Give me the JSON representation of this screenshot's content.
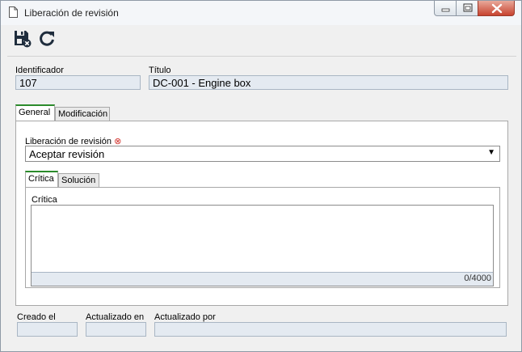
{
  "window": {
    "title": "Liberación de revisión",
    "icons": {
      "document": "document-icon",
      "minimize": "minimize-icon",
      "maximize": "maximize-icon",
      "close": "close-icon"
    }
  },
  "toolbar": {
    "save_close_icon": "save-close-icon",
    "refresh_icon": "refresh-icon"
  },
  "header": {
    "id_label": "Identificador",
    "id_value": "107",
    "title_label": "Título",
    "title_value": "DC-001 - Engine box"
  },
  "tabs": [
    {
      "label": "General",
      "active": true
    },
    {
      "label": "Modificación",
      "active": false
    }
  ],
  "general": {
    "release_label": "Liberación de revisión",
    "required_mark": "⊗",
    "release_value": "Aceptar revisión",
    "subtabs": [
      {
        "label": "Crítica",
        "active": true
      },
      {
        "label": "Solución",
        "active": false
      }
    ],
    "critique_label": "Crítica",
    "critique_value": "",
    "counter": "0/4000"
  },
  "footer": {
    "created_label": "Creado el",
    "created_value": "",
    "updated_label": "Actualizado en",
    "updated_value": "",
    "updated_by_label": "Actualizado por",
    "updated_by_value": ""
  },
  "colors": {
    "accent_tab": "#2b8b2b",
    "readonly_field": "#e4eaf1",
    "close_button": "#c7432f",
    "required": "#d0302a"
  }
}
